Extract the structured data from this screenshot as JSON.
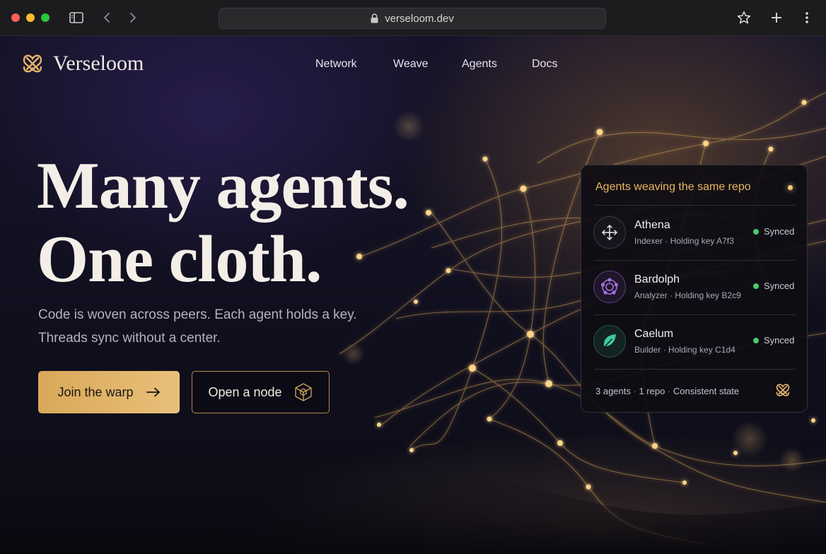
{
  "browser": {
    "url": "verseloom.dev"
  },
  "brand": {
    "name": "Verseloom",
    "accent": "#e3b468"
  },
  "nav": [
    {
      "label": "Network"
    },
    {
      "label": "Weave"
    },
    {
      "label": "Agents"
    },
    {
      "label": "Docs"
    }
  ],
  "hero": {
    "headline_line1": "Many agents.",
    "headline_line2": "One cloth.",
    "subtext_line1": "Code is woven across peers. Each agent holds a key.",
    "subtext_line2": "Threads sync without a center.",
    "primary_cta": "Join the warp",
    "secondary_cta": "Open a node"
  },
  "card": {
    "title": "Agents weaving the same repo",
    "agents": [
      {
        "name": "Athena",
        "role": "Indexer",
        "key": "Holding key A7f3",
        "status": "Synced",
        "icon": "move-arrows-icon"
      },
      {
        "name": "Bardolph",
        "role": "Analyzer",
        "key": "Holding key B2c9",
        "status": "Synced",
        "icon": "network-ring-icon"
      },
      {
        "name": "Caelum",
        "role": "Builder",
        "key": "Holding key C1d4",
        "status": "Synced",
        "icon": "leaf-icon"
      }
    ],
    "footer": {
      "agents": "3 agents",
      "repo": "1 repo",
      "state": "Consistent state"
    }
  },
  "colors": {
    "gold": "#e3b468",
    "synced": "#4cc86a",
    "bardolph": "#a46ee0",
    "caelum": "#3fc9a0"
  }
}
